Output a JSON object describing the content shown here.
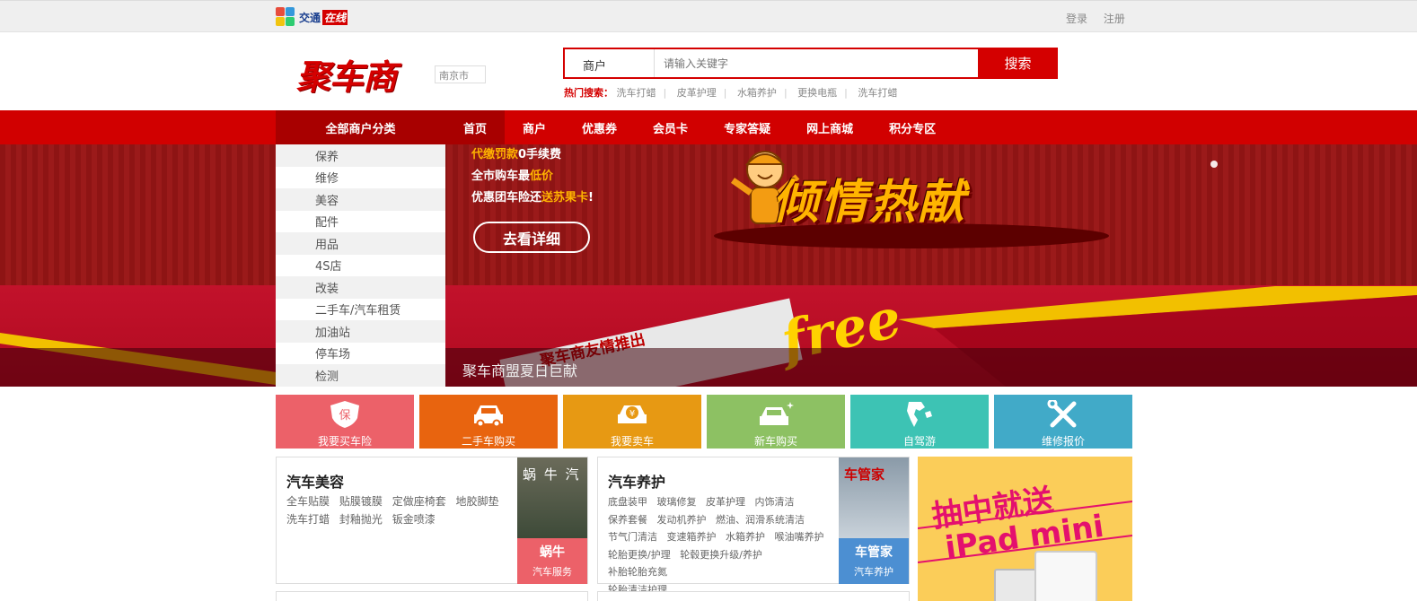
{
  "topbar": {
    "logo_text": "交通",
    "logo_badge": "在线",
    "links": [
      "登录",
      "注册"
    ]
  },
  "header": {
    "brand": "聚车商",
    "city": "南京市",
    "search": {
      "category": "商户",
      "placeholder": "请输入关键字",
      "button": "搜索"
    },
    "hot": {
      "label": "热门搜索：",
      "keywords": [
        "洗车打蜡",
        "皮革护理",
        "水箱养护",
        "更换电瓶",
        "洗车打蜡"
      ]
    }
  },
  "nav": {
    "all_categories": "全部商户分类",
    "items": [
      "首页",
      "商户",
      "优惠券",
      "会员卡",
      "专家答疑",
      "网上商城",
      "积分专区"
    ],
    "active_index": 0
  },
  "categories": [
    "保养",
    "维修",
    "美容",
    "配件",
    "用品",
    "4S店",
    "改装",
    "二手车/汽车租赁",
    "加油站",
    "停车场",
    "检测"
  ],
  "banner": {
    "line1_a": "代缴罚款",
    "line1_b": "0手续费",
    "line2_a": "全市购车最",
    "line2_b": "低价",
    "line3_a": "优惠团车险还",
    "line3_b": "送苏果卡",
    "line3_c": "!",
    "button": "去看详细",
    "headline": "倾情热献",
    "paper_text": "聚车商友情推出",
    "free_text": "free",
    "caption": "聚车商盟夏日巨献"
  },
  "tiles": [
    {
      "label": "我要买车险",
      "color": "#ec6169",
      "icon": "shield-icon"
    },
    {
      "label": "二手车购买",
      "color": "#e8640f",
      "icon": "car-icon"
    },
    {
      "label": "我要卖车",
      "color": "#e79913",
      "icon": "car-yen-icon"
    },
    {
      "label": "新车购买",
      "color": "#8dc163",
      "icon": "new-car-icon"
    },
    {
      "label": "自驾游",
      "color": "#3dc3b4",
      "icon": "map-icon"
    },
    {
      "label": "维修报价",
      "color": "#41aac8",
      "icon": "wrench-icon"
    }
  ],
  "panels": [
    {
      "title": "汽车美容",
      "tags": [
        "全车贴膜",
        "贴膜镀膜",
        "定做座椅套",
        "地胶脚垫",
        "洗车打蜡",
        "封釉抛光",
        "钣金喷漆"
      ],
      "shop_name": "蜗牛",
      "shop_sub": "汽车服务",
      "shop_color": "#ec6169",
      "photo_text": "蜗 牛 汽"
    },
    {
      "title": "汽车养护",
      "tags": [
        "底盘装甲",
        "玻璃修复",
        "皮革护理",
        "内饰清洁",
        "保养套餐",
        "发动机养护",
        "燃油、润滑系统清洁",
        "节气门清洁",
        "变速箱养护",
        "水箱养护",
        "喉油嘴养护",
        "轮胎更换/护理",
        "轮毂更换升级/养护",
        "补胎轮胎充氮",
        "轮胎清洁护理"
      ],
      "shop_name": "车管家",
      "shop_sub": "汽车养护",
      "shop_color": "#4c8fd2",
      "photo_text": "车管家"
    }
  ],
  "promo": {
    "line1": "抽中就送",
    "line2": "iPad mini"
  }
}
